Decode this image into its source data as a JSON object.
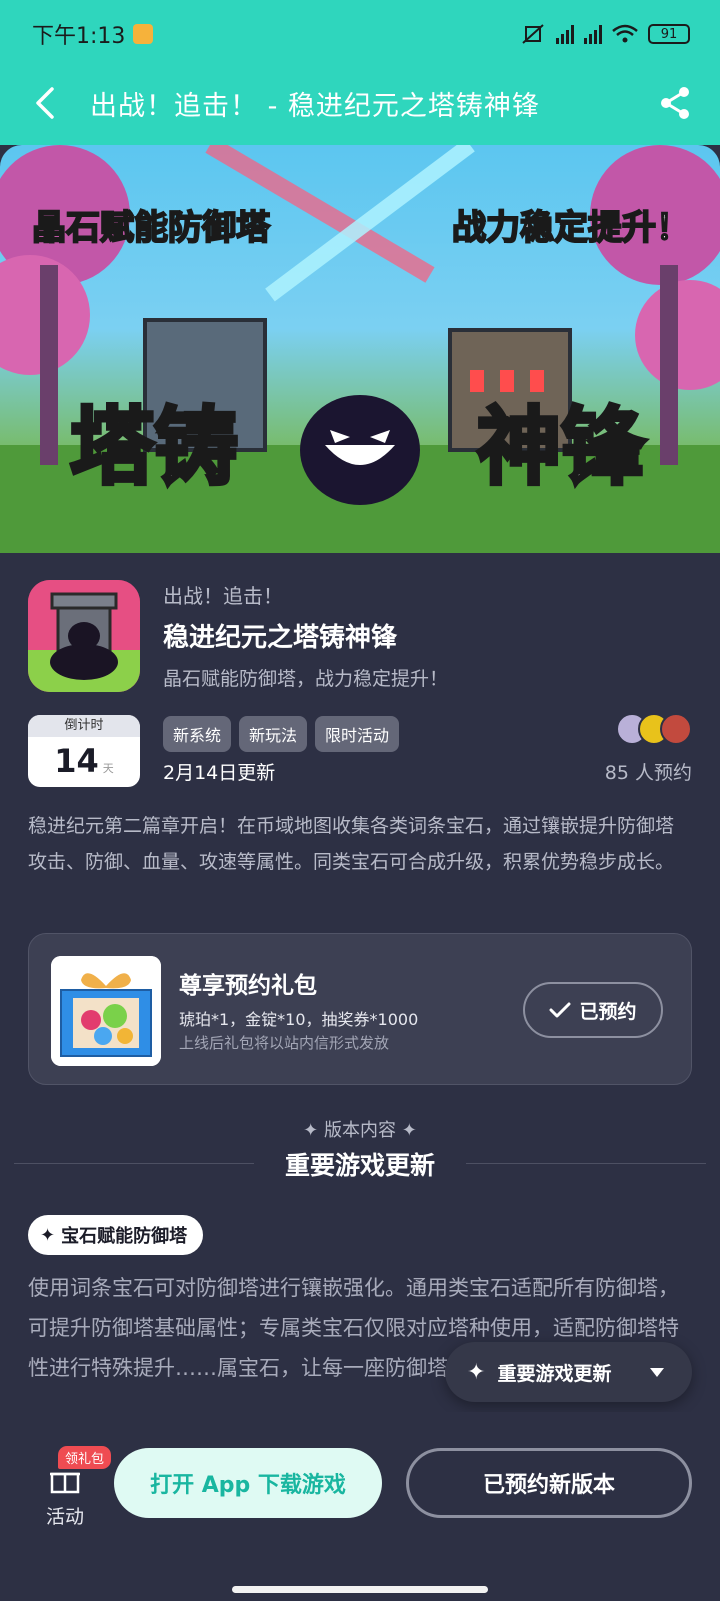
{
  "status_bar": {
    "time": "下午1:13",
    "battery": "91"
  },
  "header": {
    "title": "出战！追击！ - 稳进纪元之塔铸神锋"
  },
  "banner": {
    "caption_left": "晶石赋能防御塔",
    "caption_right": "战力稳定提升！",
    "logo_left": "塔铸",
    "logo_right": "神锋"
  },
  "game": {
    "subtitle": "出战！追击！",
    "name": "稳进纪元之塔铸神锋",
    "slogan": "晶石赋能防御塔，战力稳定提升！",
    "countdown_label": "倒计时",
    "countdown_value": "14",
    "countdown_unit": "天",
    "tags": [
      "新系统",
      "新玩法",
      "限时活动"
    ],
    "update_date": "2月14日更新",
    "reserve_count": "85 人预约"
  },
  "description": "稳进纪元第二篇章开启！在币域地图收集各类词条宝石，通过镶嵌提升防御塔攻击、防御、血量、攻速等属性。同类宝石可合成升级，积累优势稳步成长。",
  "gift": {
    "title": "尊享预约礼包",
    "items": "琥珀*1，金锭*10，抽奖券*1000",
    "note": "上线后礼包将以站内信形式发放",
    "button": "已预约"
  },
  "version_section": {
    "label": "版本内容",
    "title": "重要游戏更新",
    "feature_tag": "宝石赋能防御塔",
    "content": "使用词条宝石可对防御塔进行镶嵌强化。通用类宝石适配所有防御塔，可提升防御塔基础属性；专属类宝石仅限对应塔种使用，适配防御塔特性进行特殊提升……属宝石，让每一座防御塔都能发挥最大潜力！"
  },
  "floating_nav": {
    "label": "重要游戏更新"
  },
  "bottom_bar": {
    "activity_label": "活动",
    "activity_badge": "领礼包",
    "open_button": "打开 App 下载游戏",
    "version_button": "已预约新版本"
  },
  "colors": {
    "accent": "#2fd6bd",
    "background": "#2d3044",
    "badge": "#ef4c52"
  }
}
